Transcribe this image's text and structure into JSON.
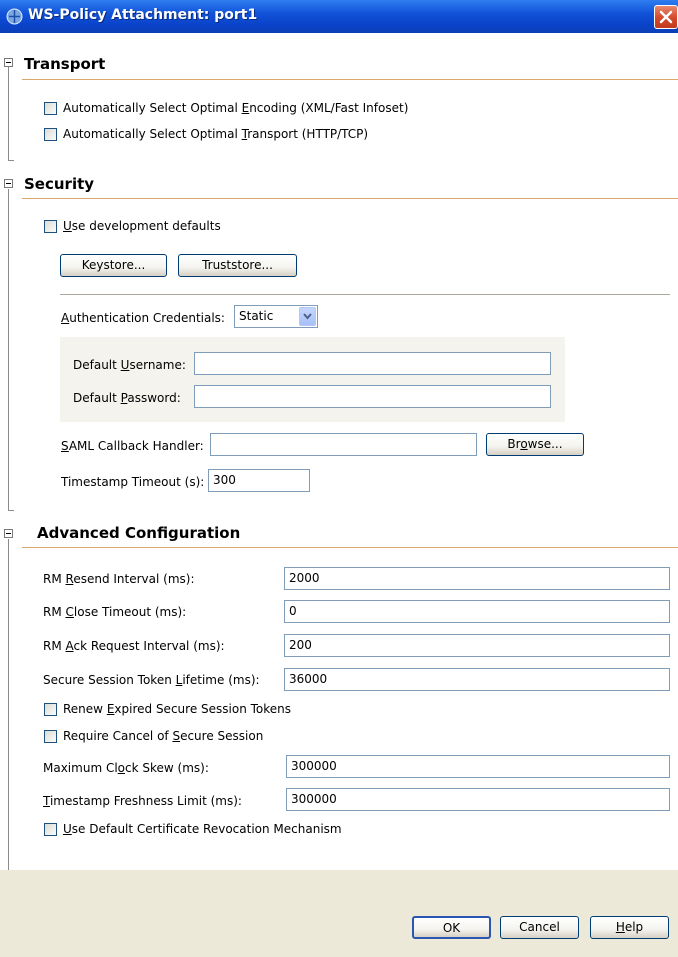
{
  "window": {
    "title": "WS-Policy Attachment: port1"
  },
  "transport": {
    "title": "Transport",
    "options": [
      {
        "pre": "Automatically Select Optimal ",
        "mn": "E",
        "post": "ncoding (XML/Fast Infoset)"
      },
      {
        "pre": "Automatically Select Optimal ",
        "mn": "T",
        "post": "ransport (HTTP/TCP)"
      }
    ]
  },
  "security": {
    "title": "Security",
    "use_dev_defaults": {
      "pre": "",
      "mn": "U",
      "post": "se development defaults"
    },
    "keystore_button": "Keystore...",
    "truststore_button": "Truststore...",
    "auth_credentials": {
      "pre": "",
      "mn": "A",
      "post": "uthentication Credentials:",
      "selected": "Static"
    },
    "default_username": {
      "pre": "Default ",
      "mn": "U",
      "post": "sername:",
      "value": ""
    },
    "default_password": {
      "pre": "Default ",
      "mn": "P",
      "post": "assword:",
      "value": ""
    },
    "saml_handler": {
      "pre": "",
      "mn": "S",
      "post": "AML Callback Handler:",
      "value": ""
    },
    "browse_button": {
      "pre": "Br",
      "mn": "o",
      "post": "wse..."
    },
    "timestamp_timeout": {
      "label": "Timestamp Timeout (s):",
      "value": "300"
    }
  },
  "advanced": {
    "title": "Advanced Configuration",
    "rm_resend": {
      "pre": "RM ",
      "mn": "R",
      "post": "esend Interval (ms):",
      "value": "2000"
    },
    "rm_close": {
      "pre": "RM ",
      "mn": "C",
      "post": "lose Timeout (ms):",
      "value": "0"
    },
    "rm_ack": {
      "pre": "RM ",
      "mn": "A",
      "post": "ck Request Interval (ms):",
      "value": "200"
    },
    "sst_lifetime": {
      "pre": "Secure Session Token ",
      "mn": "L",
      "post": "ifetime (ms):",
      "value": "36000"
    },
    "renew_tokens": {
      "pre": "Renew ",
      "mn": "E",
      "post": "xpired Secure Session Tokens"
    },
    "require_cancel": {
      "pre": "Require Cancel of ",
      "mn": "S",
      "post": "ecure Session"
    },
    "clock_skew": {
      "pre": "Maximum Cl",
      "mn": "o",
      "post": "ck Skew (ms):",
      "value": "300000"
    },
    "freshness": {
      "pre": "",
      "mn": "T",
      "post": "imestamp Freshness Limit (ms):",
      "value": "300000"
    },
    "default_revocation": {
      "pre": "",
      "mn": "U",
      "post": "se Default Certificate Revocation Mechanism"
    }
  },
  "footer": {
    "ok": "OK",
    "cancel": "Cancel",
    "help": {
      "pre": "",
      "mn": "H",
      "post": "elp"
    }
  }
}
